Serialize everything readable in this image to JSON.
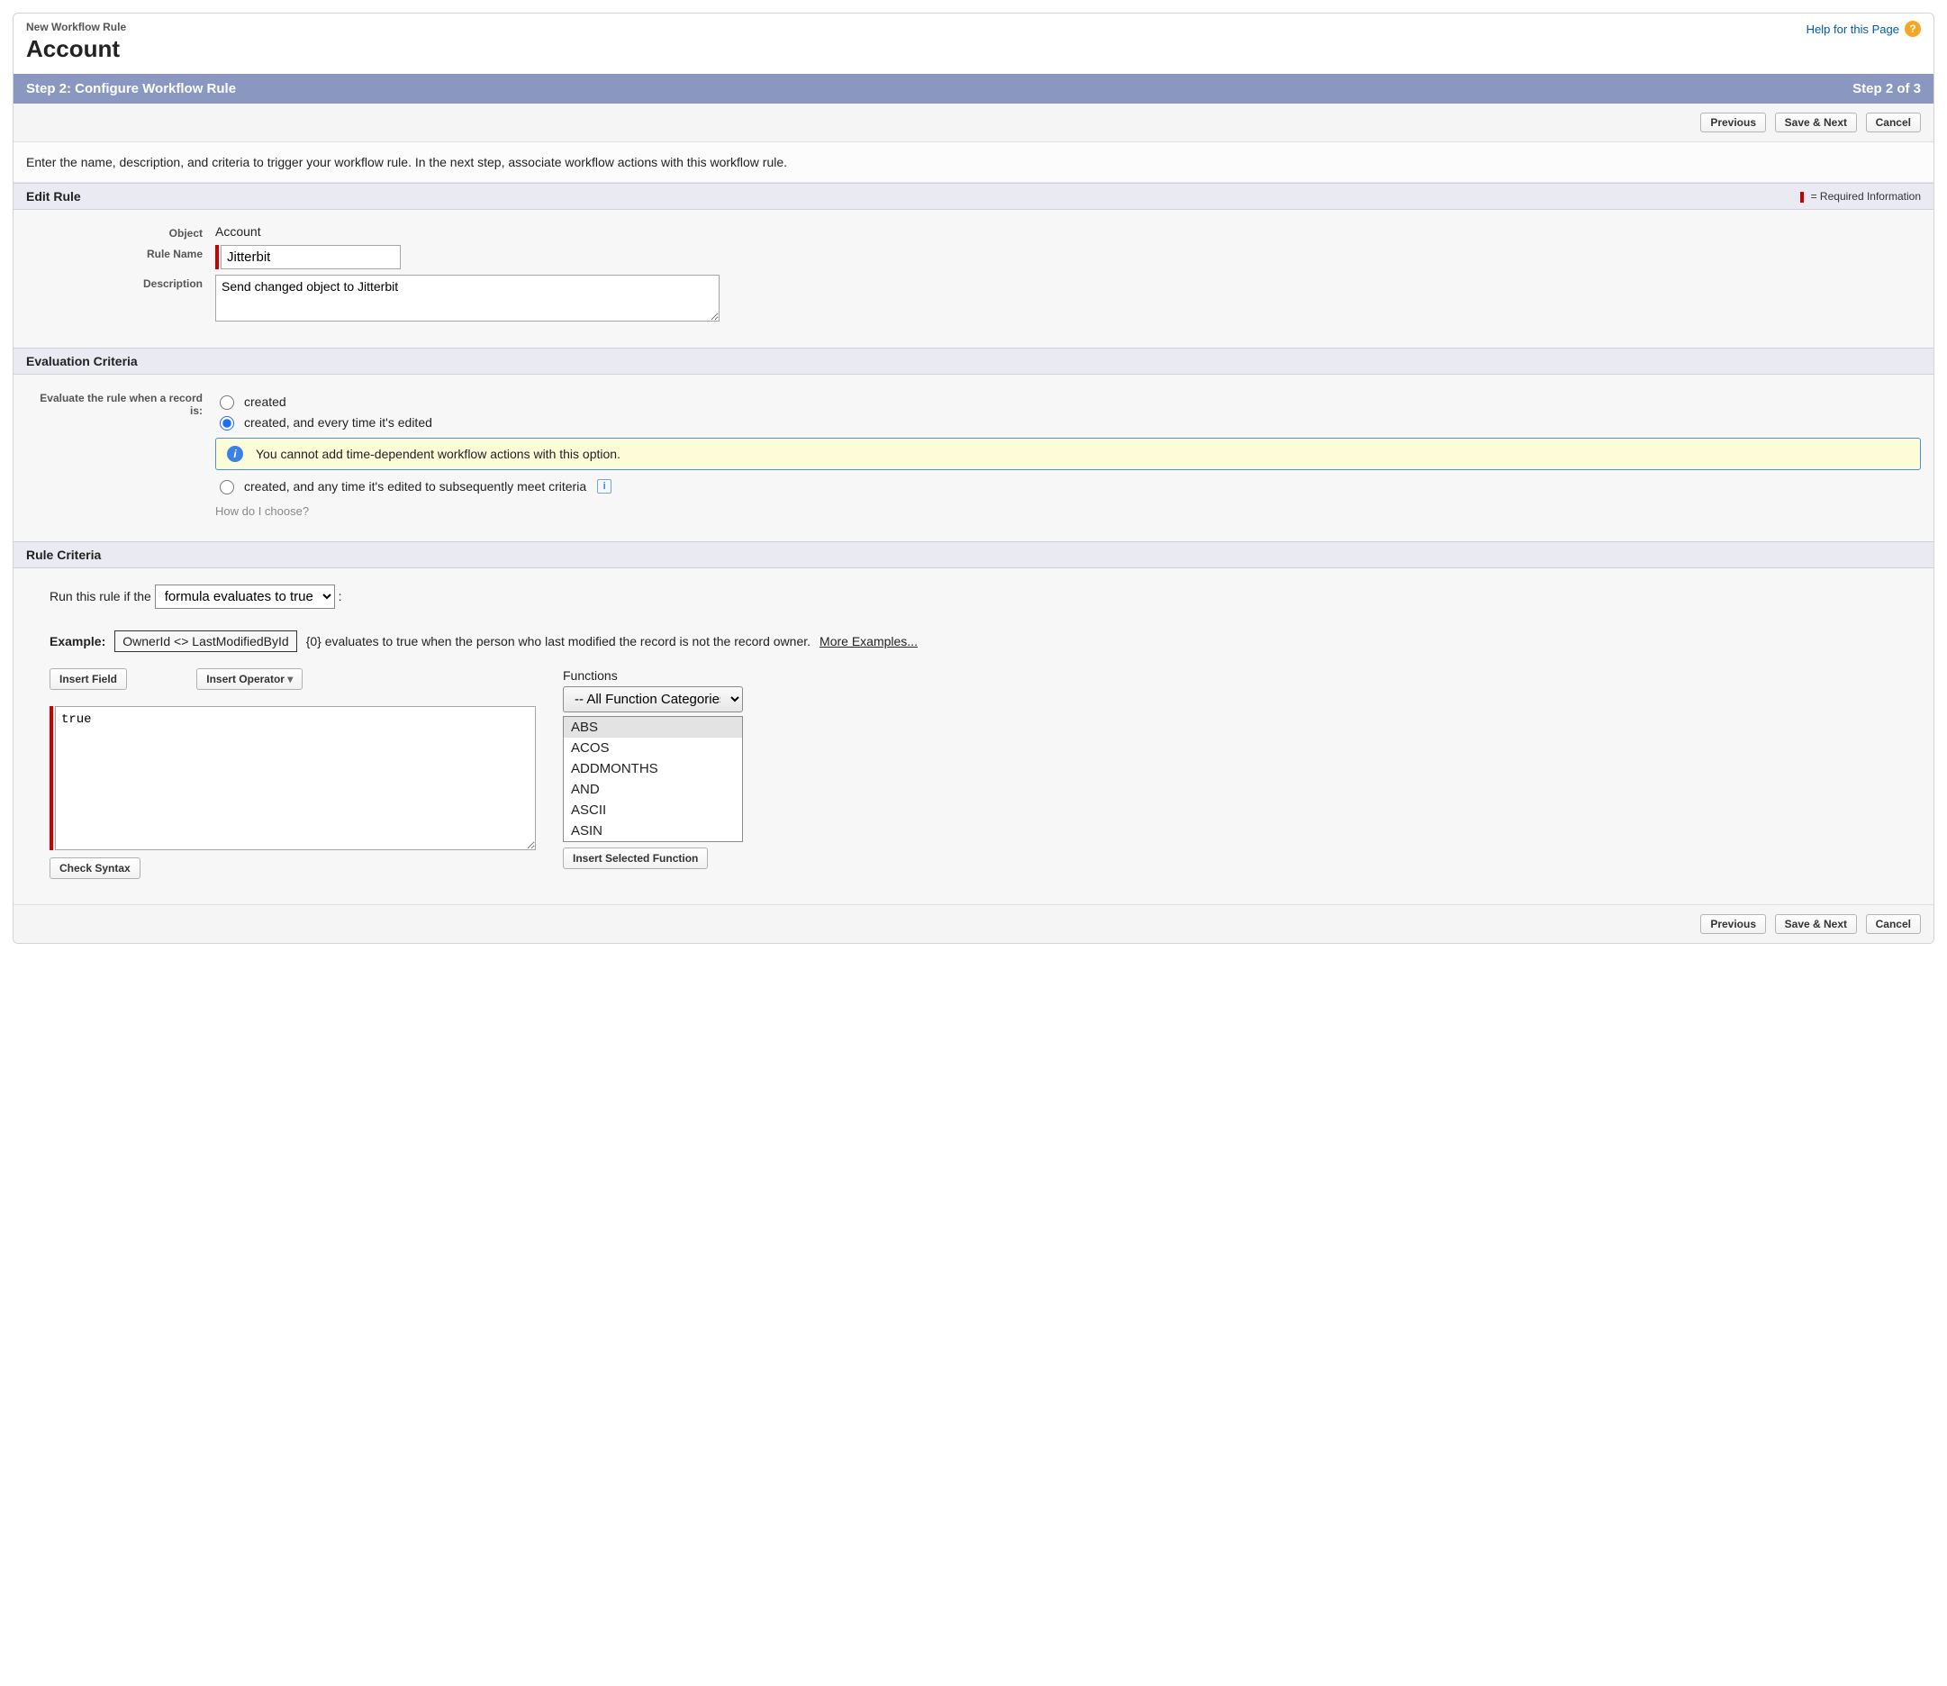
{
  "header": {
    "breadcrumb": "New Workflow Rule",
    "title": "Account",
    "help_text": "Help for this Page"
  },
  "step_bar": {
    "title": "Step 2: Configure Workflow Rule",
    "progress": "Step 2 of 3"
  },
  "buttons": {
    "previous": "Previous",
    "save_next": "Save & Next",
    "cancel": "Cancel"
  },
  "intro_text": "Enter the name, description, and criteria to trigger your workflow rule. In the next step, associate workflow actions with this workflow rule.",
  "edit_rule": {
    "section_title": "Edit Rule",
    "required_note": " = Required Information",
    "object_label": "Object",
    "object_value": "Account",
    "rule_name_label": "Rule Name",
    "rule_name_value": "Jitterbit",
    "description_label": "Description",
    "description_value": "Send changed object to Jitterbit"
  },
  "evaluation": {
    "section_title": "Evaluation Criteria",
    "label": "Evaluate the rule when a record is:",
    "opt_created": "created",
    "opt_created_edited": "created, and every time it's edited",
    "info_text": "You cannot add time-dependent workflow actions with this option.",
    "opt_meet_criteria": "created, and any time it's edited to subsequently meet criteria",
    "how_choose": "How do I choose?"
  },
  "rule_criteria": {
    "section_title": "Rule Criteria",
    "run_prefix": "Run this rule if the",
    "select_value": "formula evaluates to true",
    "run_suffix": ":",
    "example_label": "Example:",
    "example_box": "OwnerId <> LastModifiedById",
    "example_text": "{0} evaluates to true when the person who last modified the record is not the record owner.",
    "more_examples": "More Examples...",
    "insert_field": "Insert Field",
    "insert_operator": "Insert Operator",
    "formula_value": "true",
    "check_syntax": "Check Syntax",
    "functions_label": "Functions",
    "function_category": "-- All Function Categories",
    "functions": [
      "ABS",
      "ACOS",
      "ADDMONTHS",
      "AND",
      "ASCII",
      "ASIN"
    ],
    "insert_selected_function": "Insert Selected Function"
  }
}
